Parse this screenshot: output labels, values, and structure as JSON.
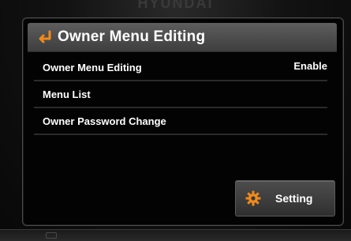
{
  "device": {
    "brand": "HYUNDAI"
  },
  "header": {
    "title": "Owner Menu Editing",
    "back_icon": "return-arrow-icon",
    "accent_color": "#f08a1c"
  },
  "menu": {
    "items": [
      {
        "label": "Owner Menu Editing",
        "value": "Enable"
      },
      {
        "label": "Menu List",
        "value": ""
      },
      {
        "label": "Owner Password Change",
        "value": ""
      }
    ]
  },
  "footer": {
    "setting_label": "Setting",
    "setting_icon": "gear-icon"
  }
}
